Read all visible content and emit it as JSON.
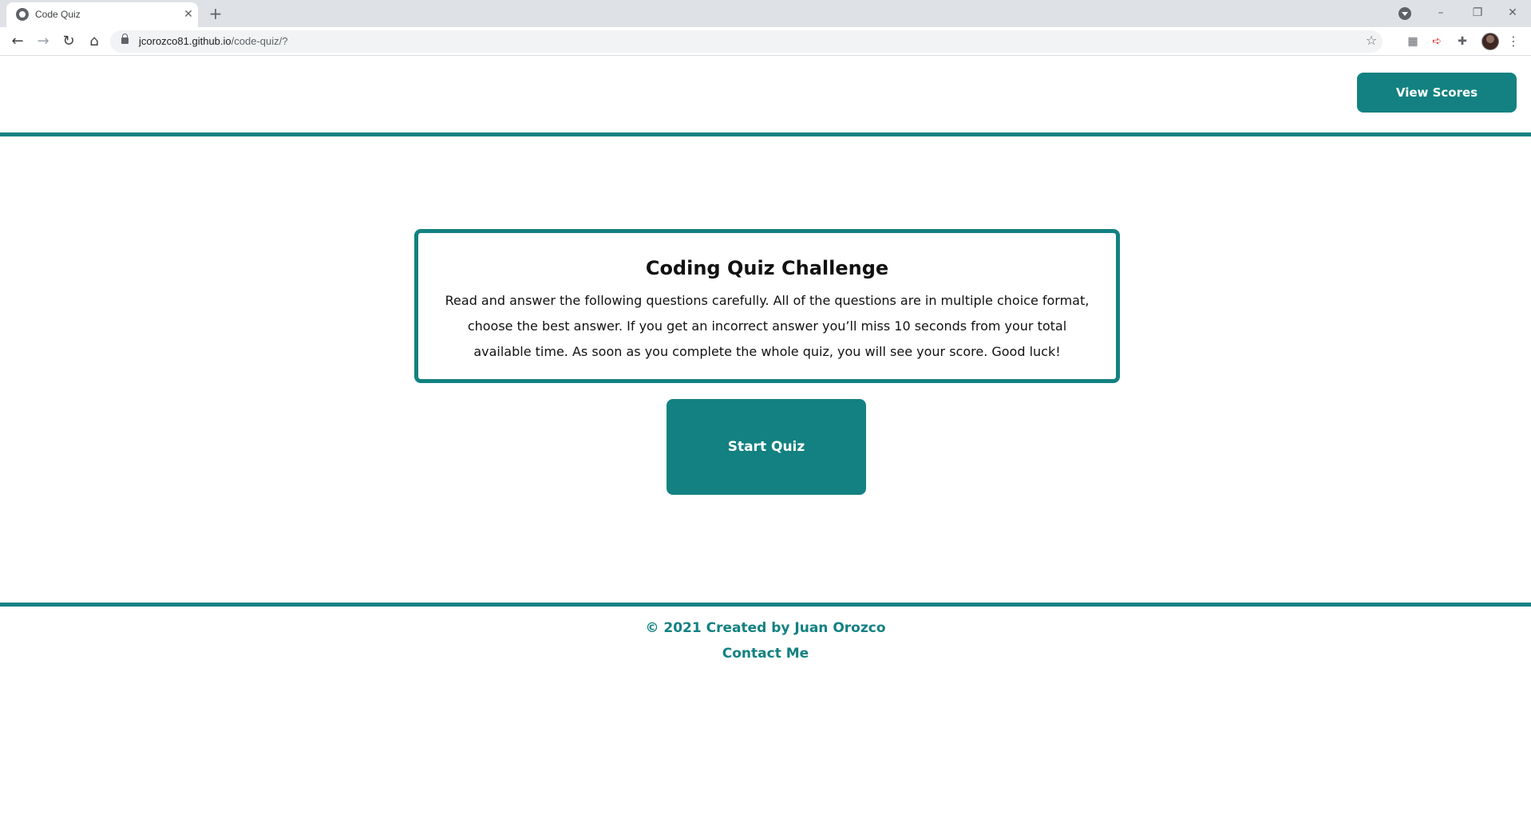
{
  "browser": {
    "tab_title": "Code Quiz",
    "tab_close_glyph": "✕",
    "new_tab_glyph": "+",
    "url_host": "jcorozco81.github.io",
    "url_path": "/code-quiz/?",
    "window_min_glyph": "–",
    "window_max_glyph": "❐",
    "window_close_glyph": "✕",
    "icons": {
      "back": "←",
      "forward": "→",
      "reload": "↻",
      "home": "⌂",
      "star": "☆",
      "qr": "▦",
      "ext_red": "➪",
      "puzzle": "✚",
      "menu": "⋮"
    }
  },
  "header": {
    "view_scores_label": "View Scores"
  },
  "intro": {
    "title": "Coding Quiz Challenge",
    "text": "Read and answer the following questions carefully. All of the questions are in multiple choice format, choose the best answer. If you get an incorrect answer you’ll miss 10 seconds from your total available time. As soon as you complete the whole quiz, you will see your score. Good luck!"
  },
  "start_quiz_label": "Start Quiz",
  "footer": {
    "copyright": "© 2021 Created by Juan Orozco",
    "contact": "Contact Me"
  },
  "colors": {
    "accent": "#138181",
    "text": "#111111",
    "background": "#ffffff"
  }
}
